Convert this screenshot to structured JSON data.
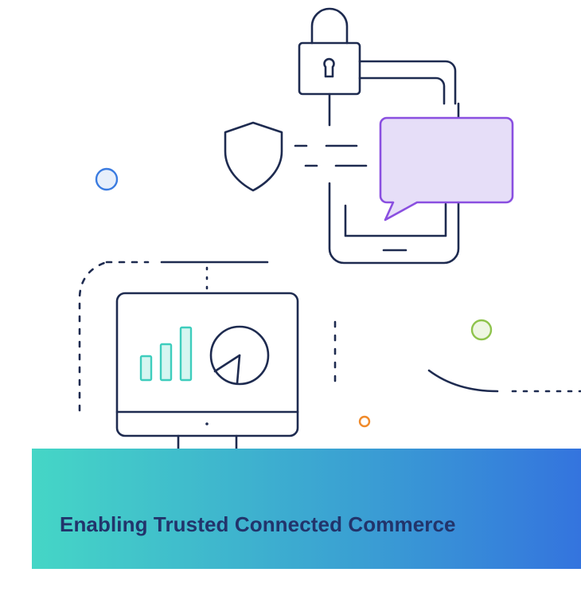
{
  "banner": {
    "title": "Enabling Trusted Connected Commerce"
  },
  "colors": {
    "line_art": "#1e2b50",
    "title_text": "#22346b",
    "gradient_start": "#45d6c6",
    "gradient_mid": "#3a9fd3",
    "gradient_end": "#3474de",
    "chat_bubble_fill": "#e6def8",
    "chat_bubble_stroke": "#8a4fe0",
    "chart_bars_fill": "#d6f6f1",
    "chart_bars_stroke": "#3ecdbd",
    "dot_blue": "#3a7be0",
    "dot_green": "#8ec34c",
    "dot_orange": "#f08a2a"
  },
  "icons": [
    "padlock-icon",
    "shield-icon",
    "smartphone-icon",
    "chat-bubble-icon",
    "monitor-icon",
    "bar-chart-icon",
    "pie-chart-icon"
  ]
}
